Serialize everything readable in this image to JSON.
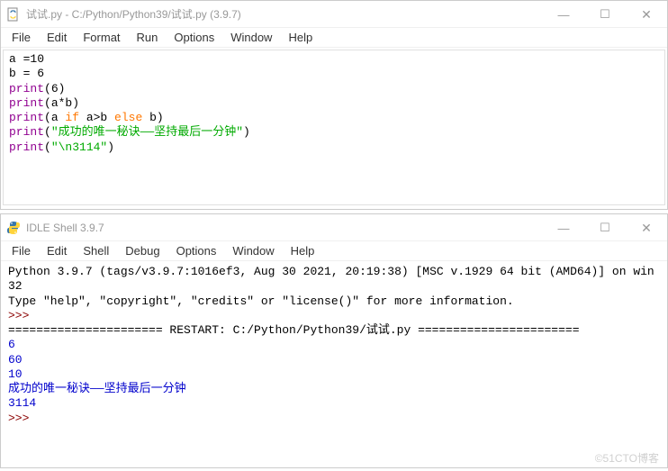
{
  "editor": {
    "title": "试试.py - C:/Python/Python39/试试.py (3.9.7)",
    "menu": [
      "File",
      "Edit",
      "Format",
      "Run",
      "Options",
      "Window",
      "Help"
    ],
    "lines": [
      [
        {
          "t": "a =",
          "c": "op"
        },
        {
          "t": "10",
          "c": "num"
        }
      ],
      [
        {
          "t": "b = ",
          "c": "op"
        },
        {
          "t": "6",
          "c": "num"
        }
      ],
      [
        {
          "t": "print",
          "c": "builtin"
        },
        {
          "t": "(",
          "c": "op"
        },
        {
          "t": "6",
          "c": "num"
        },
        {
          "t": ")",
          "c": "op"
        }
      ],
      [
        {
          "t": "print",
          "c": "builtin"
        },
        {
          "t": "(a*b)",
          "c": "op"
        }
      ],
      [
        {
          "t": "print",
          "c": "builtin"
        },
        {
          "t": "(a ",
          "c": "op"
        },
        {
          "t": "if",
          "c": "kw"
        },
        {
          "t": " a>b ",
          "c": "op"
        },
        {
          "t": "else",
          "c": "kw"
        },
        {
          "t": " b)",
          "c": "op"
        }
      ],
      [
        {
          "t": "print",
          "c": "builtin"
        },
        {
          "t": "(",
          "c": "op"
        },
        {
          "t": "\"成功的唯一秘诀——坚持最后一分钟\"",
          "c": "str"
        },
        {
          "t": ")",
          "c": "op"
        }
      ],
      [
        {
          "t": "print",
          "c": "builtin"
        },
        {
          "t": "(",
          "c": "op"
        },
        {
          "t": "\"\\n3114\"",
          "c": "str"
        },
        {
          "t": ")",
          "c": "op"
        }
      ]
    ]
  },
  "shell": {
    "title": "IDLE Shell 3.9.7",
    "menu": [
      "File",
      "Edit",
      "Shell",
      "Debug",
      "Options",
      "Window",
      "Help"
    ],
    "banner1": "Python 3.9.7 (tags/v3.9.7:1016ef3, Aug 30 2021, 20:19:38) [MSC v.1929 64 bit (AMD64)] on win32",
    "banner2": "Type \"help\", \"copyright\", \"credits\" or \"license()\" for more information.",
    "prompt": ">>>",
    "restart_line": "====================== RESTART: C:/Python/Python39/试试.py =======================",
    "output": [
      "6",
      "60",
      "10",
      "成功的唯一秘诀——坚持最后一分钟",
      "",
      "3114"
    ]
  },
  "controls": {
    "min": "—",
    "max": "☐",
    "close": "✕"
  },
  "watermark": "©51CTO博客"
}
